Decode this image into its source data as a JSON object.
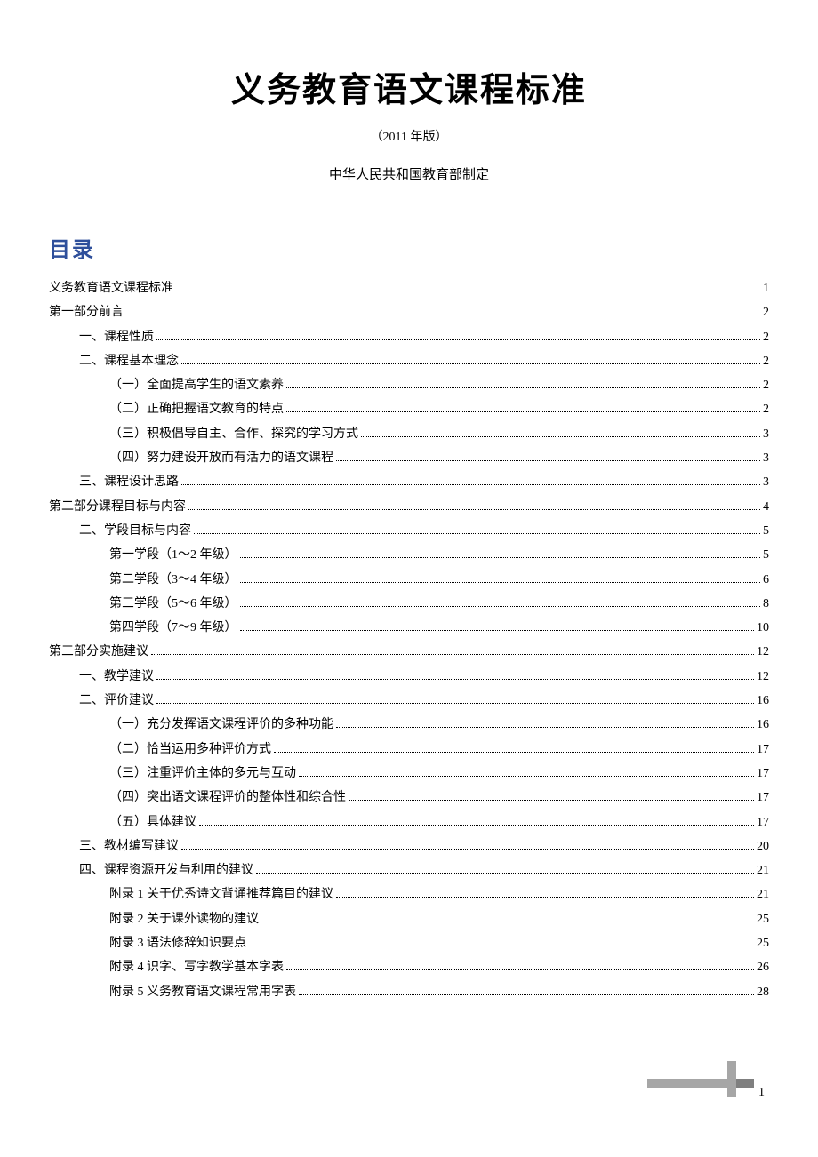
{
  "title": "义务教育语文课程标准",
  "version": "（2011 年版）",
  "publisher": "中华人民共和国教育部制定",
  "toc_heading": "目录",
  "page_number": "1",
  "toc": [
    {
      "label": "义务教育语文课程标准",
      "page": "1",
      "level": 0
    },
    {
      "label": "第一部分前言",
      "page": "2",
      "level": 0
    },
    {
      "label": "一、课程性质",
      "page": "2",
      "level": 1
    },
    {
      "label": "二、课程基本理念",
      "page": "2",
      "level": 1
    },
    {
      "label": "（一）全面提高学生的语文素养",
      "page": "2",
      "level": 2
    },
    {
      "label": "（二）正确把握语文教育的特点",
      "page": "2",
      "level": 2
    },
    {
      "label": "（三）积极倡导自主、合作、探究的学习方式",
      "page": "3",
      "level": 2
    },
    {
      "label": "（四）努力建设开放而有活力的语文课程",
      "page": "3",
      "level": 2
    },
    {
      "label": "三、课程设计思路",
      "page": "3",
      "level": 1
    },
    {
      "label": "第二部分课程目标与内容",
      "page": "4",
      "level": 0
    },
    {
      "label": "二、学段目标与内容",
      "page": "5",
      "level": 1
    },
    {
      "label": "第一学段（1～2 年级）",
      "page": "5",
      "level": 2
    },
    {
      "label": "第二学段（3～4 年级）",
      "page": "6",
      "level": 2
    },
    {
      "label": "第三学段（5～6 年级）",
      "page": "8",
      "level": 2
    },
    {
      "label": "第四学段（7～9 年级）",
      "page": "10",
      "level": 2
    },
    {
      "label": "第三部分实施建议",
      "page": "12",
      "level": 0
    },
    {
      "label": "一、教学建议",
      "page": "12",
      "level": 1
    },
    {
      "label": "二、评价建议",
      "page": "16",
      "level": 1
    },
    {
      "label": "（一）充分发挥语文课程评价的多种功能",
      "page": "16",
      "level": 2
    },
    {
      "label": "（二）恰当运用多种评价方式",
      "page": "17",
      "level": 2
    },
    {
      "label": "（三）注重评价主体的多元与互动",
      "page": "17",
      "level": 2
    },
    {
      "label": "（四）突出语文课程评价的整体性和综合性",
      "page": "17",
      "level": 2
    },
    {
      "label": "（五）具体建议",
      "page": "17",
      "level": 2
    },
    {
      "label": "三、教材编写建议",
      "page": "20",
      "level": 1
    },
    {
      "label": "四、课程资源开发与利用的建议",
      "page": "21",
      "level": 1
    },
    {
      "label": "附录 1 关于优秀诗文背诵推荐篇目的建议",
      "page": "21",
      "level": 2
    },
    {
      "label": "附录 2 关于课外读物的建议",
      "page": "25",
      "level": 2
    },
    {
      "label": "附录 3 语法修辞知识要点",
      "page": "25",
      "level": 2
    },
    {
      "label": "附录 4 识字、写字教学基本字表",
      "page": "26",
      "level": 2
    },
    {
      "label": "附录 5 义务教育语文课程常用字表",
      "page": "28",
      "level": 2
    }
  ]
}
